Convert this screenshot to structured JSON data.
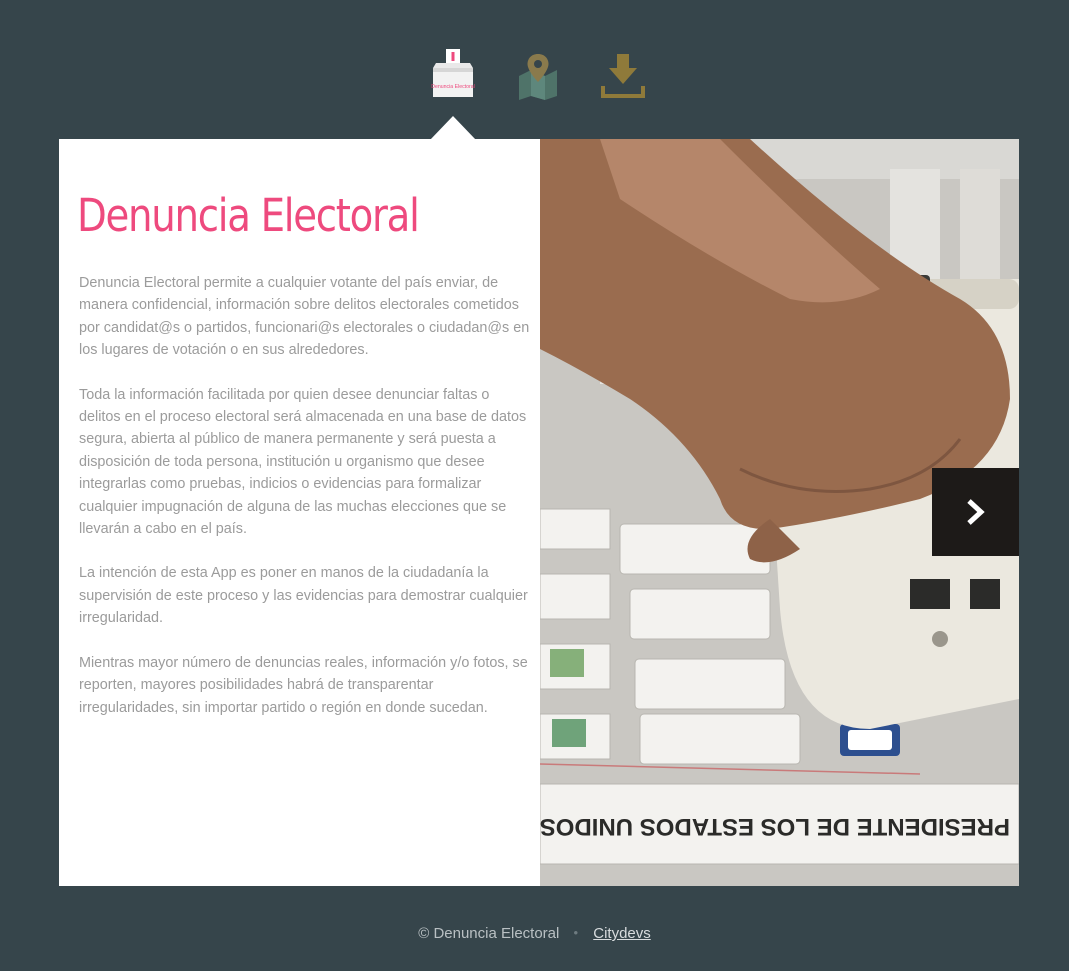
{
  "nav": {
    "items": [
      {
        "name": "ballot-box",
        "icon": "ballot-box-icon",
        "label": "Denuncia Electoral",
        "active": true
      },
      {
        "name": "map",
        "icon": "map-pin-icon",
        "active": false
      },
      {
        "name": "download",
        "icon": "download-icon",
        "active": false
      }
    ]
  },
  "main": {
    "title": "Denuncia Electoral",
    "paragraphs": [
      "Denuncia Electoral permite a cualquier votante del país enviar, de manera confidencial, información sobre delitos electorales cometidos por candidat@s o partidos, funcionari@s electorales o ciudadan@s en los lugares de votación o en sus alrededores.",
      "Toda la información facilitada por quien desee denunciar faltas o delitos en el proceso electoral será almacenada en una base de datos segura, abierta al público de manera permanente y será puesta a disposición de toda persona, institución u organismo que desee integrarlas como pruebas, indicios o evidencias para formalizar cualquier impugnación de alguna de las muchas elecciones que se llevarán a cabo en el país.",
      "La intención de esta App es poner en manos de la ciudadanía la supervisión de este proceso y las evidencias para demostrar cualquier irregularidad.",
      "Mientras mayor número de denuncias reales, información y/o fotos, se reporten, mayores posibilidades habrá de transparentar irregularidades, sin importar partido o región en donde sucedan."
    ]
  },
  "slider": {
    "image": "ballot-voting-photo",
    "next_icon": "chevron-right-icon"
  },
  "footer": {
    "copyright": "© Denuncia Electoral",
    "separator": "•",
    "link_label": "Citydevs"
  },
  "colors": {
    "background": "#36454b",
    "accent_pink": "#ee4a7e",
    "map_green": "#5b8278",
    "download_olive": "#8f7a3a",
    "body_text": "#9b9b9b"
  }
}
